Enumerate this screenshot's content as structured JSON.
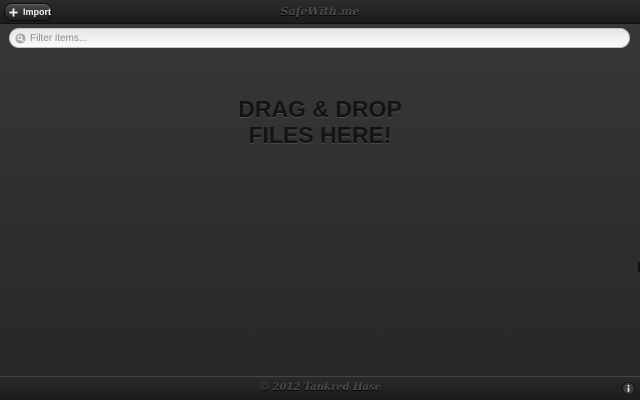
{
  "toolbar": {
    "import_label": "Import",
    "import_icon": "plus-icon"
  },
  "header": {
    "app_title": "SafeWith.me"
  },
  "search": {
    "placeholder": "Filter items...",
    "value": "",
    "icon": "search-icon"
  },
  "dropzone": {
    "line1": "DRAG & DROP",
    "line2": "FILES HERE!"
  },
  "footer": {
    "copyright": "© 2012 Tankred Hase",
    "info_icon": "info-icon"
  },
  "colors": {
    "background_top": "#383838",
    "background_bottom": "#262626",
    "bar": "#1b1b1b",
    "dropzone_text": "#141414",
    "title_text": "#4a4a4a"
  }
}
